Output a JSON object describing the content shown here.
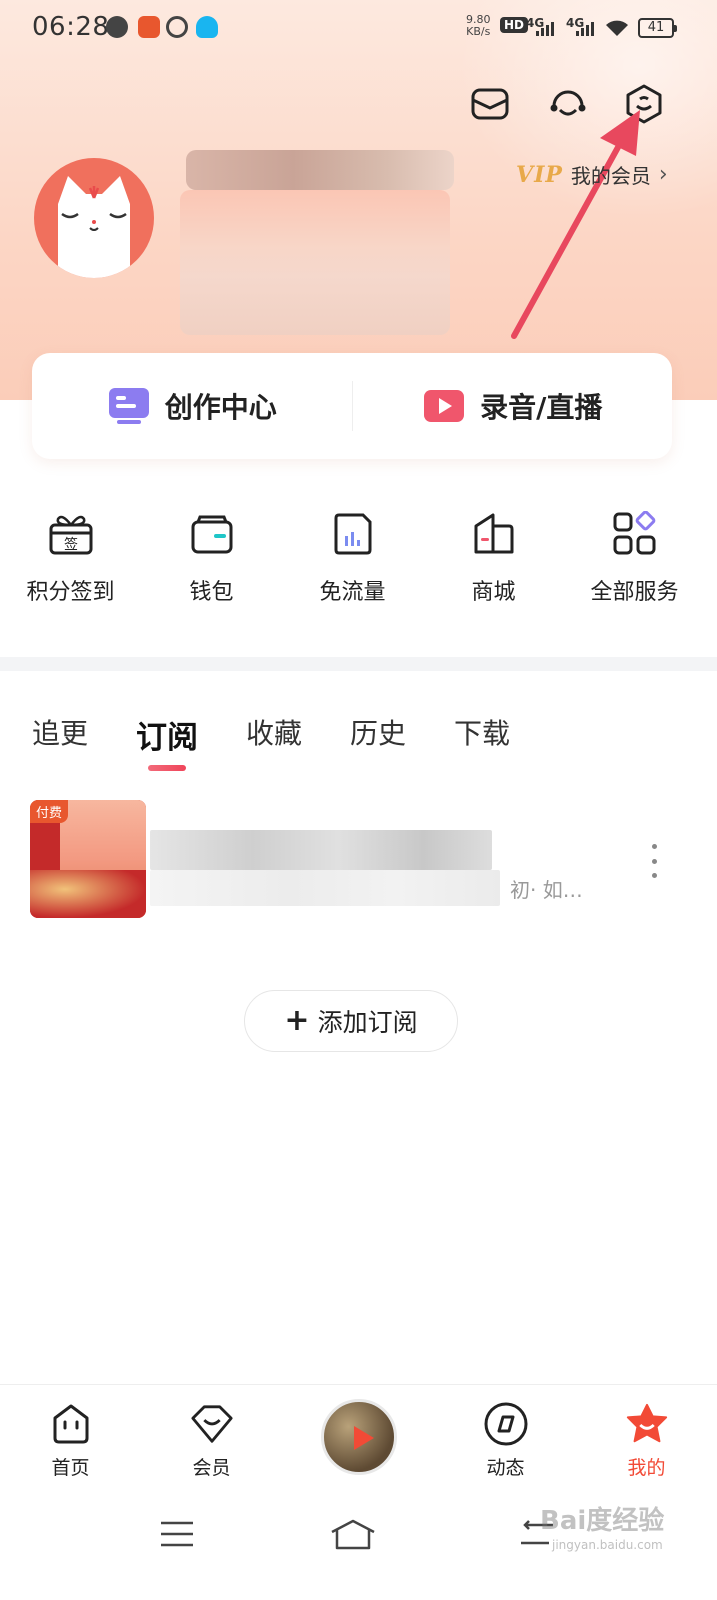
{
  "status_bar": {
    "time": "06:28",
    "net_speed_value": "9.80",
    "net_speed_unit": "KB/s",
    "hd_label": "HD",
    "signal1": "4G",
    "signal2": "4G",
    "battery": "41"
  },
  "header": {
    "vip_logo": "VIP",
    "vip_text": "我的会员",
    "vip_chevron": "›"
  },
  "creator_bar": {
    "creation_center": "创作中心",
    "record_live": "录音/直播"
  },
  "services": [
    {
      "label": "积分签到",
      "icon": "gift-sign-icon"
    },
    {
      "label": "钱包",
      "icon": "wallet-icon"
    },
    {
      "label": "免流量",
      "icon": "data-free-icon"
    },
    {
      "label": "商城",
      "icon": "mall-icon"
    },
    {
      "label": "全部服务",
      "icon": "all-services-icon"
    }
  ],
  "tabs": [
    {
      "label": "追更",
      "active": false
    },
    {
      "label": "订阅",
      "active": true
    },
    {
      "label": "收藏",
      "active": false
    },
    {
      "label": "历史",
      "active": false
    },
    {
      "label": "下载",
      "active": false
    }
  ],
  "subscription": {
    "cover_tag": "付费",
    "tail_text": "初· 如…"
  },
  "add_subscription": {
    "plus": "+",
    "label": "添加订阅"
  },
  "bottom_nav": [
    {
      "label": "首页",
      "icon": "home-icon"
    },
    {
      "label": "会员",
      "icon": "vip-diamond-icon"
    },
    {
      "label": "动态",
      "icon": "moments-icon"
    },
    {
      "label": "我的",
      "icon": "my-star-icon",
      "active": true
    }
  ],
  "watermark": {
    "text": "Bai度经验",
    "sub": "jingyan.baidu.com"
  },
  "colors": {
    "accent": "#f24a36",
    "hero_bg": "#fcd6c5",
    "vip_gold": "#e8a94a",
    "tab_indicator": "#f0455a"
  }
}
